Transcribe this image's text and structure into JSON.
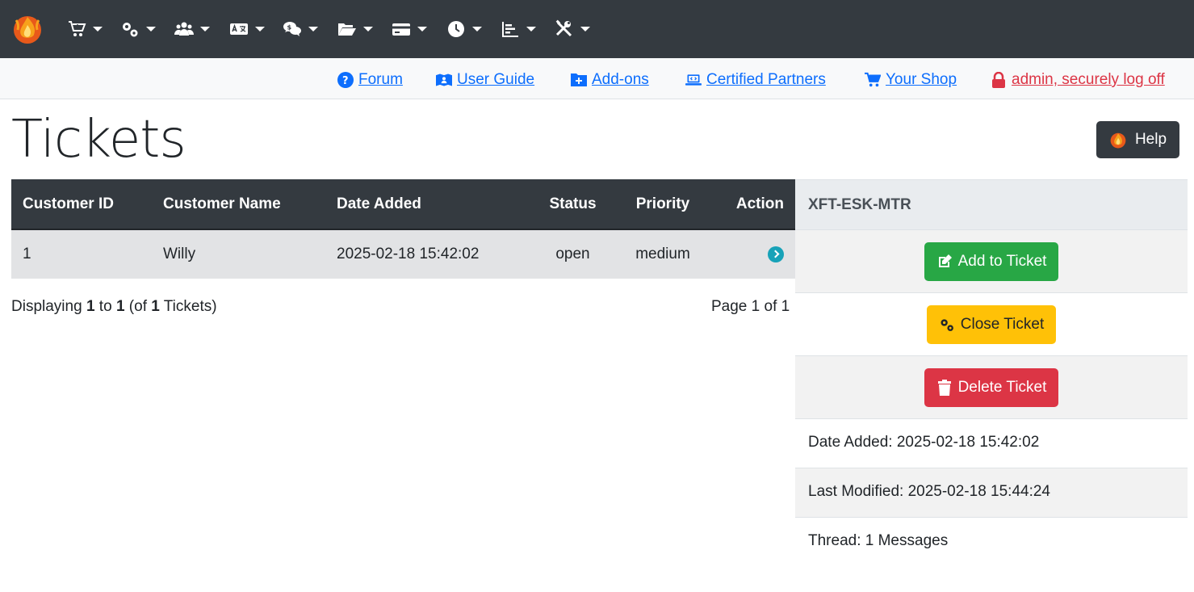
{
  "colors": {
    "navbar_bg": "#343a40",
    "link": "#0d6efd",
    "danger": "#dc3545",
    "success": "#28a745",
    "warning": "#ffc107",
    "info": "#17a2b8"
  },
  "navbar": {
    "menus": [
      {
        "icon": "cart-icon"
      },
      {
        "icon": "gears-icon"
      },
      {
        "icon": "users-icon"
      },
      {
        "icon": "language-icon"
      },
      {
        "icon": "comments-dollar-icon"
      },
      {
        "icon": "folder-open-icon"
      },
      {
        "icon": "credit-card-icon"
      },
      {
        "icon": "clock-icon"
      },
      {
        "icon": "chart-bar-icon"
      },
      {
        "icon": "tools-icon"
      }
    ]
  },
  "links": {
    "forum": "Forum",
    "user_guide": "User Guide",
    "addons": "Add-ons",
    "partners": "Certified Partners",
    "shop": "Your Shop",
    "logout": "admin, securely log off"
  },
  "page": {
    "title": "Tickets",
    "help": "Help"
  },
  "table": {
    "headers": [
      "Customer ID",
      "Customer Name",
      "Date Added",
      "Status",
      "Priority",
      "Action"
    ],
    "rows": [
      {
        "customer_id": "1",
        "customer_name": "Willy",
        "date_added": "2025-02-18 15:42:02",
        "status": "open",
        "priority": "medium"
      }
    ]
  },
  "pagination": {
    "prefix": "Displaying",
    "from": "1",
    "to_word": "to",
    "to": "1",
    "of_open": "(of",
    "total": "1",
    "suffix": "Tickets)",
    "page_text": "Page 1 of 1"
  },
  "panel": {
    "ticket_code": "XFT-ESK-MTR",
    "add_label": "Add to Ticket",
    "close_label": "Close Ticket",
    "delete_label": "Delete Ticket",
    "date_added": "Date Added: 2025-02-18 15:42:02",
    "last_modified": "Last Modified: 2025-02-18 15:44:24",
    "thread": "Thread: 1 Messages"
  }
}
